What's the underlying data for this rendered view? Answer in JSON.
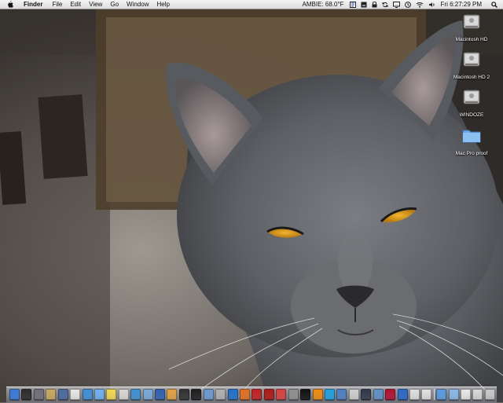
{
  "menubar": {
    "apple_icon": "apple-logo-icon",
    "app_name": "Finder",
    "items": [
      "File",
      "Edit",
      "View",
      "Go",
      "Window",
      "Help"
    ],
    "weather": "AMBIE: 68.0°F",
    "clock": "Fri 6:27:29 PM",
    "status_icons": [
      "script-icon",
      "keychain-icon",
      "lock-icon",
      "sync-icon",
      "display-icon",
      "time-machine-icon",
      "wifi-icon",
      "volume-icon"
    ],
    "spotlight_icon": "spotlight-search-icon"
  },
  "desktop": {
    "wallpaper": "gray cat close-up photo",
    "icons": [
      {
        "label": "Macintosh HD",
        "type": "hard-drive-icon"
      },
      {
        "label": "Macintosh HD 2",
        "type": "hard-drive-icon"
      },
      {
        "label": "WINDOZE",
        "type": "hard-drive-icon"
      },
      {
        "label": "Mac Pro proof",
        "type": "folder-icon"
      }
    ]
  },
  "dock": {
    "apps": [
      {
        "name": "finder",
        "color": "#3a78d8"
      },
      {
        "name": "dashboard",
        "color": "#2b2b2b"
      },
      {
        "name": "system-preferences",
        "color": "#6f6f7a"
      },
      {
        "name": "preview",
        "color": "#c7a860"
      },
      {
        "name": "iphoto",
        "color": "#4a6aa0"
      },
      {
        "name": "ical",
        "color": "#e8e8e8"
      },
      {
        "name": "safari",
        "color": "#3f8fd8"
      },
      {
        "name": "ichat",
        "color": "#6fb0f0"
      },
      {
        "name": "stickies",
        "color": "#f0d850"
      },
      {
        "name": "textedit",
        "color": "#d8d8d8"
      },
      {
        "name": "itunes",
        "color": "#4090d0"
      },
      {
        "name": "mail",
        "color": "#7aa8d8"
      },
      {
        "name": "keynote",
        "color": "#3060b0"
      },
      {
        "name": "garageband",
        "color": "#e0a040"
      },
      {
        "name": "imovie",
        "color": "#303030"
      },
      {
        "name": "terminal-app",
        "color": "#1c1c1c"
      },
      {
        "name": "xcode",
        "color": "#6a9ad0"
      },
      {
        "name": "automator",
        "color": "#b0b0b0"
      },
      {
        "name": "network-utility",
        "color": "#2070c8"
      },
      {
        "name": "firefox",
        "color": "#e07020"
      },
      {
        "name": "photo-booth",
        "color": "#c02020"
      },
      {
        "name": "acrobat",
        "color": "#b01818"
      },
      {
        "name": "filemaker",
        "color": "#d84040"
      },
      {
        "name": "disk-utility",
        "color": "#909090"
      },
      {
        "name": "terminal",
        "color": "#101010"
      },
      {
        "name": "vlc",
        "color": "#f08a10"
      },
      {
        "name": "skype",
        "color": "#20a0e0"
      },
      {
        "name": "screen-sharing",
        "color": "#5080c0"
      },
      {
        "name": "bluetooth",
        "color": "#d0d0d0"
      },
      {
        "name": "remote-desktop",
        "color": "#303848"
      },
      {
        "name": "utilities",
        "color": "#6090c8"
      },
      {
        "name": "flash",
        "color": "#b01030"
      },
      {
        "name": "app-store",
        "color": "#2a68c8"
      },
      {
        "name": "activity-monitor",
        "color": "#e0e0e0"
      },
      {
        "name": "console",
        "color": "#e0e0e0"
      }
    ],
    "stacks": [
      {
        "name": "applications-stack",
        "color": "#5a9ae0"
      },
      {
        "name": "documents-stack",
        "color": "#8ab8e8"
      },
      {
        "name": "library-stack",
        "color": "#e8e8e8"
      },
      {
        "name": "downloads-stack",
        "color": "#d8d8d8"
      },
      {
        "name": "trash",
        "color": "#c8c8c8"
      }
    ]
  }
}
